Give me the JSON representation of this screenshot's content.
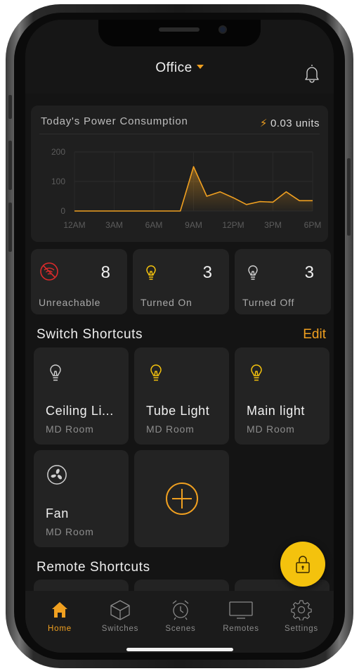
{
  "header": {
    "location": "Office"
  },
  "power": {
    "title": "Today's Power Consumption",
    "value": "0.03 units"
  },
  "chart_data": {
    "type": "area",
    "title": "Today's Power Consumption",
    "categories": [
      "12AM",
      "1AM",
      "2AM",
      "3AM",
      "4AM",
      "5AM",
      "6AM",
      "7AM",
      "8AM",
      "9AM",
      "10AM",
      "11AM",
      "12PM",
      "1PM",
      "2PM",
      "3PM",
      "4PM",
      "5PM",
      "6PM"
    ],
    "values": [
      0,
      0,
      0,
      0,
      0,
      0,
      0,
      0,
      0,
      150,
      50,
      65,
      45,
      22,
      32,
      30,
      65,
      35,
      35
    ],
    "x_ticks": [
      "12AM",
      "3AM",
      "6AM",
      "9AM",
      "12PM",
      "3PM",
      "6PM"
    ],
    "y_ticks": [
      "0",
      "100",
      "200"
    ],
    "ylim": [
      0,
      200
    ],
    "grid": true,
    "line_color": "#f0a020"
  },
  "stats": [
    {
      "value": "8",
      "label": "Unreachable",
      "icon": "wifi-off-icon"
    },
    {
      "value": "3",
      "label": "Turned On",
      "icon": "bulb-on-icon"
    },
    {
      "value": "3",
      "label": "Turned Off",
      "icon": "bulb-off-icon"
    }
  ],
  "switch_shortcuts": {
    "heading": "Switch Shortcuts",
    "edit": "Edit",
    "items": [
      {
        "name": "Ceiling Li...",
        "room": "MD Room",
        "icon": "bulb-off-icon"
      },
      {
        "name": "Tube Light",
        "room": "MD Room",
        "icon": "bulb-on-icon"
      },
      {
        "name": "Main light",
        "room": "MD Room",
        "icon": "bulb-on-icon"
      },
      {
        "name": "Fan",
        "room": "MD Room",
        "icon": "fan-icon"
      }
    ]
  },
  "remote_shortcuts": {
    "heading": "Remote Shortcuts"
  },
  "tabs": [
    {
      "label": "Home",
      "icon": "home-icon",
      "active": true
    },
    {
      "label": "Switches",
      "icon": "cube-icon",
      "active": false
    },
    {
      "label": "Scenes",
      "icon": "alarm-clock-icon",
      "active": false
    },
    {
      "label": "Remotes",
      "icon": "tv-icon",
      "active": false
    },
    {
      "label": "Settings",
      "icon": "gear-icon",
      "active": false
    }
  ],
  "colors": {
    "accent": "#f0a020",
    "fab": "#f4c20d",
    "background": "#141414",
    "card": "#232323",
    "alert": "#d92b2b"
  }
}
